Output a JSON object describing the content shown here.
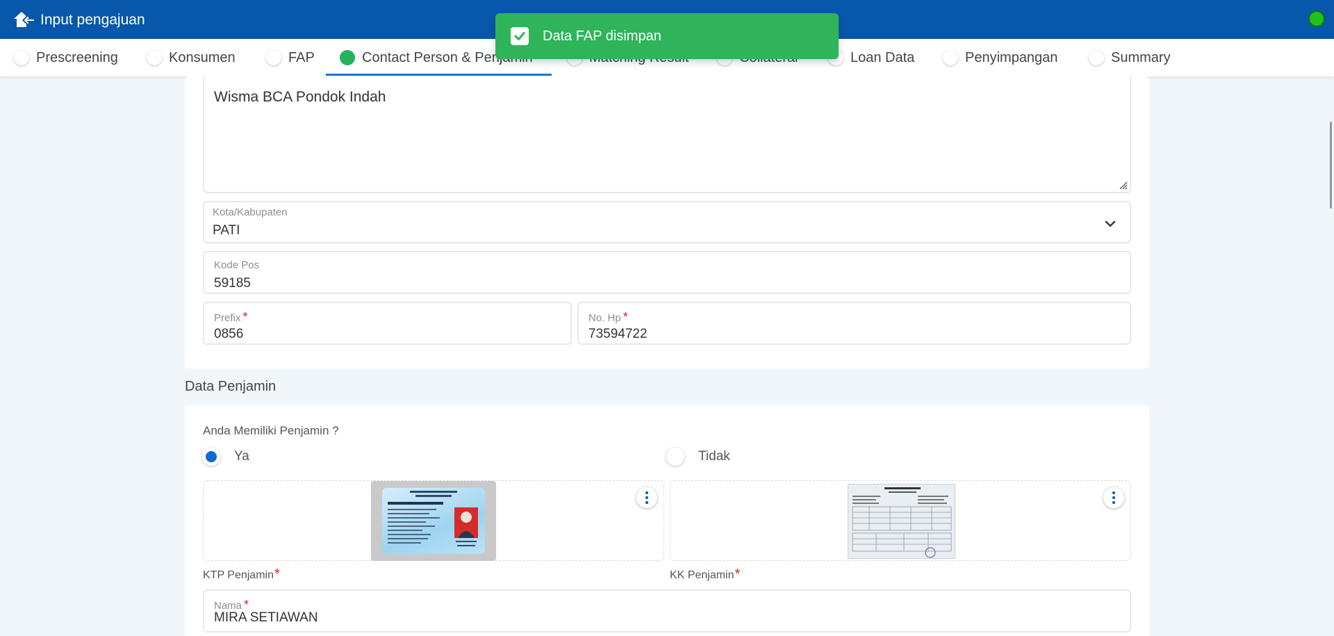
{
  "header": {
    "title": "Input pengajuan"
  },
  "toast": {
    "message": "Data FAP disimpan"
  },
  "tabs": [
    {
      "label": "Prescreening"
    },
    {
      "label": "Konsumen"
    },
    {
      "label": "FAP"
    },
    {
      "label": "Contact Person & Penjamin",
      "active": true
    },
    {
      "label": "Matching Result"
    },
    {
      "label": "Collateral"
    },
    {
      "label": "Loan Data"
    },
    {
      "label": "Penyimpangan"
    },
    {
      "label": "Summary"
    }
  ],
  "contact": {
    "address_value": "Wisma BCA Pondok Indah",
    "city": {
      "label": "Kota/Kabupaten",
      "value": "PATI"
    },
    "postal": {
      "label": "Kode Pos",
      "value": "59185"
    },
    "prefix": {
      "label": "Prefix",
      "value": "0856",
      "required_mark": "*"
    },
    "phone": {
      "label": "No. Hp",
      "value": "73594722",
      "required_mark": "*"
    }
  },
  "penjamin": {
    "heading": "Data Penjamin",
    "question": "Anda Memiliki Penjamin ?",
    "option_yes": "Ya",
    "option_no": "Tidak",
    "selected": "Ya",
    "ktp_caption": "KTP Penjamin",
    "kk_caption": "KK Penjamin",
    "required_mark": "*",
    "name": {
      "label": "Nama",
      "value": "MIRA SETIAWAN",
      "required_mark": "*"
    }
  },
  "colors": {
    "header_bg": "#0758ab",
    "toast_bg": "#2fb45a",
    "active_step": "#26b35a",
    "tab_underline": "#1677d2",
    "required": "#e02020",
    "radio_selected": "#0b6bd1",
    "status_online": "#1fc11f"
  },
  "icons": {
    "back": "back-home-arrow-icon",
    "toast": "check-icon",
    "select": "chevron-down-icon",
    "menu": "kebab-menu-icon"
  }
}
